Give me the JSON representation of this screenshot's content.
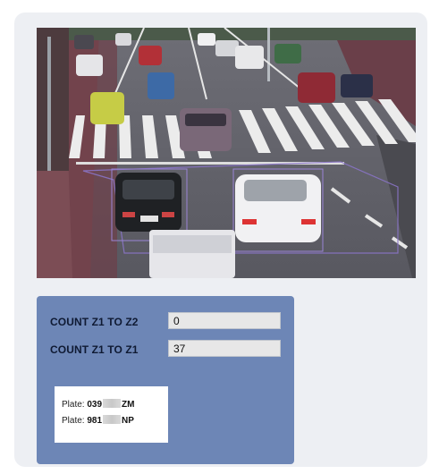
{
  "camera": {
    "name": "traffic-camera-feed"
  },
  "counters": [
    {
      "label": "COUNT Z1  TO Z2",
      "value": "0"
    },
    {
      "label": "COUNT Z1  TO Z1",
      "value": "37"
    }
  ],
  "plates": [
    {
      "prefix": "Plate: ",
      "start": "039",
      "end": "ZM"
    },
    {
      "prefix": "Plate: ",
      "start": "981",
      "end": "NP"
    }
  ],
  "colors": {
    "panel": "#edeff3",
    "stats_panel": "#6d86b6",
    "zone_outline": "#8a74c7"
  }
}
